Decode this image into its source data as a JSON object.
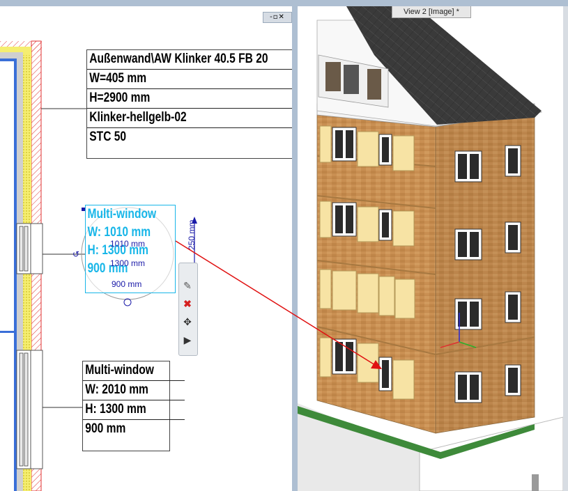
{
  "window": {
    "view2_title": "View 2 [Image] *",
    "window_controls": "-▫✕"
  },
  "wall_label": {
    "rows": [
      "Außenwand\\AW Klinker 40.5 FB 20",
      "W=405 mm",
      "H=2900 mm",
      "Klinker-hellgelb-02",
      "STC 50"
    ]
  },
  "selected_label": {
    "rows": [
      "Multi-window",
      "W: 1010 mm",
      "H: 1300 mm",
      "900 mm"
    ]
  },
  "dimensions": {
    "width_dim": "1010 mm",
    "height_dim": "1300 mm",
    "sill_dim": "900 mm",
    "vertical_dim": "250 mm"
  },
  "window_label": {
    "rows": [
      "Multi-window",
      "W: 2010 mm",
      "H: 1300 mm",
      "900 mm"
    ]
  },
  "toolbar": {
    "edit_icon": "pencil-icon",
    "delete_icon": "delete-icon",
    "move_icon": "move-icon",
    "more_icon": "play-icon"
  },
  "colors": {
    "brick": "#c98f52",
    "roof": "#3a3a3a",
    "selection": "#18b6e8",
    "leader": "#e01010",
    "grass": "#3e8a3a"
  }
}
